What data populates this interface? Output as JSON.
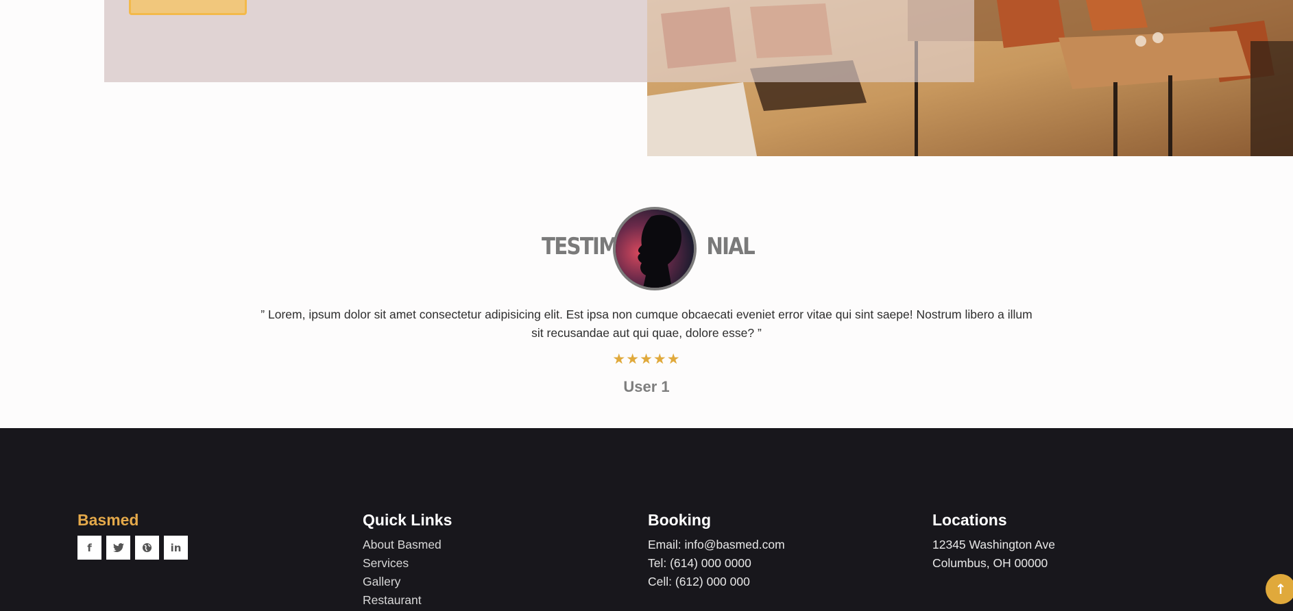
{
  "testimonial": {
    "title_left": "TESTIM",
    "title_right": "NIAL",
    "quote": "” Lorem, ipsum dolor sit amet consectetur adipisicing elit. Est ipsa non cumque obcaecati eveniet error vitae qui sint saepe! Nostrum libero a illum sit recusandae aut qui quae, dolore esse? ”",
    "rating": 5,
    "stars": "★★★★★",
    "user": "User 1"
  },
  "footer": {
    "brand": {
      "name": "Basmed",
      "color": "#e4a94a"
    },
    "socials": [
      {
        "icon": "facebook-icon",
        "glyph": "f"
      },
      {
        "icon": "twitter-icon",
        "glyph": "ṭ"
      },
      {
        "icon": "globe-icon",
        "glyph": "◍"
      },
      {
        "icon": "linkedin-icon",
        "glyph": "in"
      }
    ],
    "quick_links": {
      "heading": "Quick Links",
      "items": [
        "About Basmed",
        "Services",
        "Gallery",
        "Restaurant"
      ]
    },
    "booking": {
      "heading": "Booking",
      "email": "Email: info@basmed.com",
      "tel": "Tel: (614) 000 0000",
      "cell": "Cell: (612) 000 000"
    },
    "locations": {
      "heading": "Locations",
      "address_line1": "12345 Washington Ave",
      "address_line2": "Columbus, OH 00000"
    }
  },
  "scroll_top": {
    "glyph": "↑"
  },
  "colors": {
    "accent": "#e0a93b",
    "footer_bg": "#18171c",
    "panel": "#e0d3d3"
  }
}
